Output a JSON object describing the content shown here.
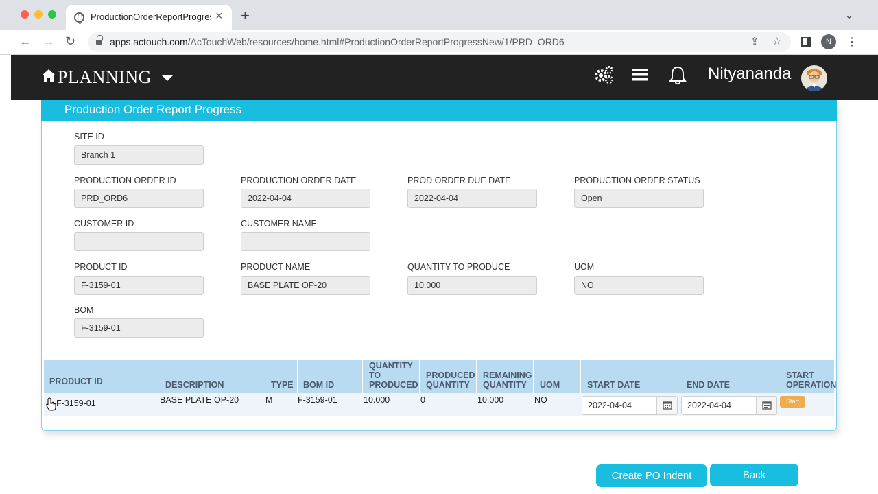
{
  "browser": {
    "tab_title": "ProductionOrderReportProgress",
    "url_host": "apps.actouch.com",
    "url_path": "/AcTouchWeb/resources/home.html#ProductionOrderReportProgressNew/1/PRD_ORD6",
    "profile_initial": "N"
  },
  "header": {
    "brand": "PLANNING",
    "username": "Nityananda"
  },
  "panel": {
    "title": "Production Order Report Progress"
  },
  "form": {
    "site_id": {
      "label": "SITE ID",
      "value": "Branch 1"
    },
    "production_order_id": {
      "label": "PRODUCTION ORDER ID",
      "value": "PRD_ORD6"
    },
    "production_order_date": {
      "label": "PRODUCTION ORDER DATE",
      "value": "2022-04-04"
    },
    "prod_order_due_date": {
      "label": "PROD ORDER DUE DATE",
      "value": "2022-04-04"
    },
    "production_order_status": {
      "label": "PRODUCTION ORDER STATUS",
      "value": "Open"
    },
    "customer_id": {
      "label": "CUSTOMER ID",
      "value": ""
    },
    "customer_name": {
      "label": "CUSTOMER NAME",
      "value": ""
    },
    "product_id": {
      "label": "PRODUCT ID",
      "value": "F-3159-01"
    },
    "product_name": {
      "label": "PRODUCT NAME",
      "value": "BASE PLATE OP-20"
    },
    "quantity_to_produce": {
      "label": "QUANTITY TO PRODUCE",
      "value": "10.000"
    },
    "uom": {
      "label": "UOM",
      "value": "NO"
    },
    "bom": {
      "label": "BOM",
      "value": "F-3159-01"
    }
  },
  "table": {
    "headers": {
      "product_id": "PRODUCT ID",
      "description": "DESCRIPTION",
      "type": "TYPE",
      "bom_id": "BOM ID",
      "qty_to_produce_1": "QUANTITY",
      "qty_to_produce_2": "TO",
      "qty_to_produce_3": "PRODUCED",
      "produced_qty_1": "PRODUCED",
      "produced_qty_2": "QUANTITY",
      "remaining_qty_1": "REMAINING",
      "remaining_qty_2": "QUANTITY",
      "uom": "UOM",
      "start_date": "START DATE",
      "end_date": "END DATE",
      "start_operation_1": "START",
      "start_operation_2": "OPERATION"
    },
    "rows": [
      {
        "product_id": "F-3159-01",
        "description": "BASE PLATE OP-20",
        "type": "M",
        "bom_id": "F-3159-01",
        "quantity_to_produce": "10.000",
        "produced_quantity": "0",
        "remaining_quantity": "10.000",
        "uom": "NO",
        "start_date": "2022-04-04",
        "end_date": "2022-04-04",
        "start_label": "Start"
      }
    ]
  },
  "actions": {
    "create_po_indent": "Create PO Indent",
    "back": "Back"
  },
  "colors": {
    "accent": "#18bde0",
    "header_bg": "#222222",
    "table_header_bg": "#b8dbf2",
    "start_button": "#f0ad4e"
  }
}
